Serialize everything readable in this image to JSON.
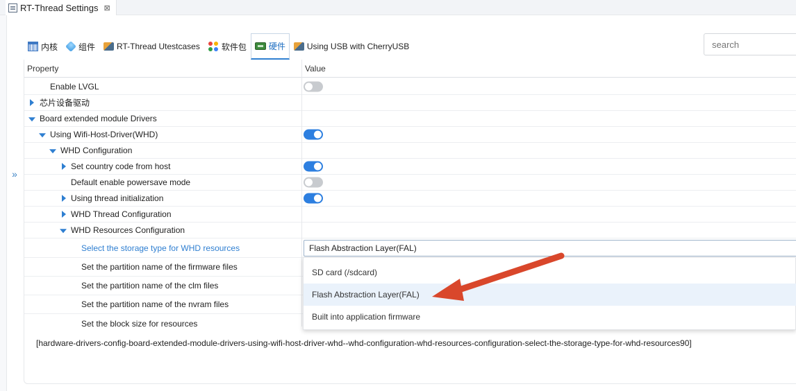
{
  "editor_tab": {
    "title": "RT-Thread Settings",
    "close_glyph": "⊠"
  },
  "expand_glyph": "»",
  "config_tabs": [
    {
      "label": "内核",
      "icon": "table-icon",
      "active": false
    },
    {
      "label": "组件",
      "icon": "cube-icon",
      "active": false
    },
    {
      "label": "RT-Thread Utestcases",
      "icon": "tool-icon",
      "active": false
    },
    {
      "label": "软件包",
      "icon": "package-icon",
      "active": false
    },
    {
      "label": "硬件",
      "icon": "hardware-board-icon",
      "active": true
    },
    {
      "label": "Using USB with CherryUSB",
      "icon": "tool-icon",
      "active": false
    }
  ],
  "search": {
    "placeholder": "search"
  },
  "table": {
    "headers": {
      "property": "Property",
      "value": "Value"
    },
    "rows": [
      {
        "label": "Enable LVGL",
        "expander": "none",
        "value_type": "toggle",
        "value": false
      },
      {
        "label": "芯片设备驱动",
        "expander": "collapsed",
        "value_type": "none"
      },
      {
        "label": "Board extended module Drivers",
        "expander": "expanded",
        "value_type": "none"
      },
      {
        "label": "Using Wifi-Host-Driver(WHD)",
        "expander": "expanded",
        "value_type": "toggle",
        "value": true
      },
      {
        "label": "WHD Configuration",
        "expander": "expanded",
        "value_type": "none"
      },
      {
        "label": "Set country code from host",
        "expander": "collapsed",
        "value_type": "toggle",
        "value": true
      },
      {
        "label": "Default enable powersave mode",
        "expander": "none",
        "value_type": "toggle",
        "value": false
      },
      {
        "label": "Using thread initialization",
        "expander": "collapsed",
        "value_type": "toggle",
        "value": true
      },
      {
        "label": "WHD Thread Configuration",
        "expander": "collapsed",
        "value_type": "none"
      },
      {
        "label": "WHD Resources Configuration",
        "expander": "expanded",
        "value_type": "none"
      },
      {
        "label": "Select the storage type for WHD resources",
        "expander": "none",
        "value_type": "select",
        "value": "Flash Abstraction Layer(FAL)",
        "highlighted": true
      },
      {
        "label": "Set the partition name of the firmware files",
        "expander": "none",
        "value_type": "none"
      },
      {
        "label": "Set the partition name of the clm files",
        "expander": "none",
        "value_type": "none"
      },
      {
        "label": "Set the partition name of the nvram files",
        "expander": "none",
        "value_type": "none"
      },
      {
        "label": "Set the block size for resources",
        "expander": "none",
        "value_type": "none"
      }
    ]
  },
  "dropdown": {
    "options": [
      {
        "label": "SD card (/sdcard)",
        "selected": false
      },
      {
        "label": "Flash Abstraction Layer(FAL)",
        "selected": true
      },
      {
        "label": "Built into application firmware",
        "selected": false
      }
    ]
  },
  "path_text": "[hardware-drivers-config-board-extended-module-drivers-using-wifi-host-driver-whd--whd-configuration-whd-resources-configuration-select-the-storage-type-for-whd-resources90]",
  "colors": {
    "accent": "#2f7fd1",
    "toggle_on": "#2d7fe0",
    "toggle_off": "#c8cbcf",
    "annotation_arrow": "#d9472b"
  }
}
